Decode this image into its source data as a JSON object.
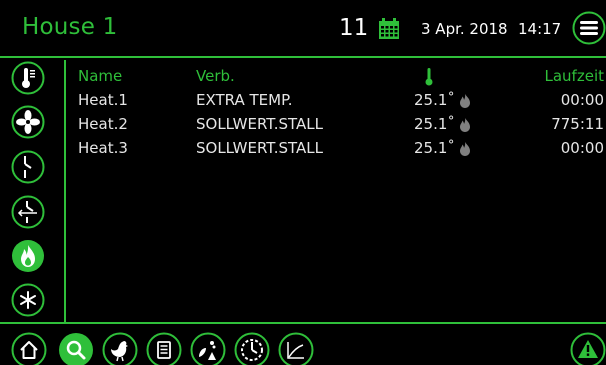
{
  "header": {
    "title": "House 1",
    "day_number": "11",
    "date": "3 Apr. 2018",
    "time": "14:17"
  },
  "table": {
    "columns": {
      "name": "Name",
      "verb": "Verb.",
      "laufzeit": "Laufzeit"
    },
    "rows": [
      {
        "name": "Heat.1",
        "verb": "EXTRA TEMP.",
        "temp": "25.1˚",
        "laufzeit": "00:00"
      },
      {
        "name": "Heat.2",
        "verb": "SOLLWERT.STALL",
        "temp": "25.1˚",
        "laufzeit": "775:11"
      },
      {
        "name": "Heat.3",
        "verb": "SOLLWERT.STALL",
        "temp": "25.1˚",
        "laufzeit": "00:00"
      }
    ]
  },
  "icons": {
    "calendar": "calendar-icon",
    "menu": "hamburger-menu-icon",
    "thermometer": "thermometer-icon",
    "fan": "fan-icon",
    "inlet": "inlet-icon",
    "ventilation": "ventilation-icon",
    "flame": "flame-icon",
    "snowflake": "snowflake-icon",
    "home": "home-icon",
    "search": "search-icon",
    "hen": "hen-icon",
    "document": "document-icon",
    "feed": "feed-icon",
    "clock": "clock-icon",
    "graph": "graph-icon",
    "alarm": "alarm-icon"
  },
  "colors": {
    "accent": "#2fbf3a",
    "background": "#000000",
    "text": "#e6e6e6"
  }
}
